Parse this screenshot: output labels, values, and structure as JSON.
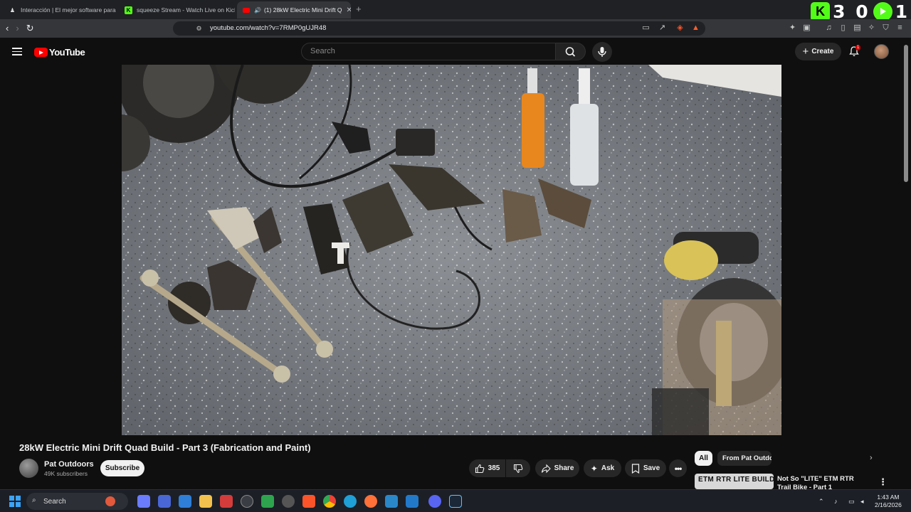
{
  "browser": {
    "tabs": [
      {
        "title": "Interacción | El mejor software para p",
        "favicon": "chess-icon",
        "active": false
      },
      {
        "title": "squeeze Stream - Watch Live on Kick",
        "favicon": "kick-icon",
        "active": false
      },
      {
        "title": "(1) 28kW Electric Mini Drift Q",
        "favicon": "youtube-icon",
        "active": true,
        "audio": "speaker-icon"
      }
    ],
    "url": "youtube.com/watch?v=7RMP0gUJR48",
    "colors": {
      "tabstrip": "#202124",
      "toolbar": "#35363a"
    }
  },
  "kick_overlay": {
    "badge_k": "K",
    "count_left": "3 0",
    "count_right": "1",
    "colors": {
      "kick_green": "#53fc18"
    }
  },
  "youtube": {
    "logo_text": "YouTube",
    "search_placeholder": "Search",
    "create_label": "Create",
    "notification_count": "1",
    "colors": {
      "brand_red": "#ff0000",
      "background": "#0f0f0f"
    }
  },
  "video": {
    "title": "28kW Electric Mini Drift Quad Build - Part 3 (Fabrication and Paint)",
    "channel_name": "Pat Outdoors",
    "subscriber_count": "49K subscribers",
    "subscribe_label": "Subscribe",
    "like_count": "385",
    "share_label": "Share",
    "ask_label": "Ask",
    "save_label": "Save"
  },
  "recommendations": {
    "chips": [
      "All",
      "From Pat Outdo"
    ],
    "items": [
      {
        "title": "Not So \"LITE\" ETM RTR Trail Bike - Part 1",
        "thumb_text": "ETM RTR LITE BUILD"
      }
    ]
  },
  "taskbar": {
    "search_label": "Search",
    "time": "1:43 AM",
    "date": "2/16/2026"
  }
}
